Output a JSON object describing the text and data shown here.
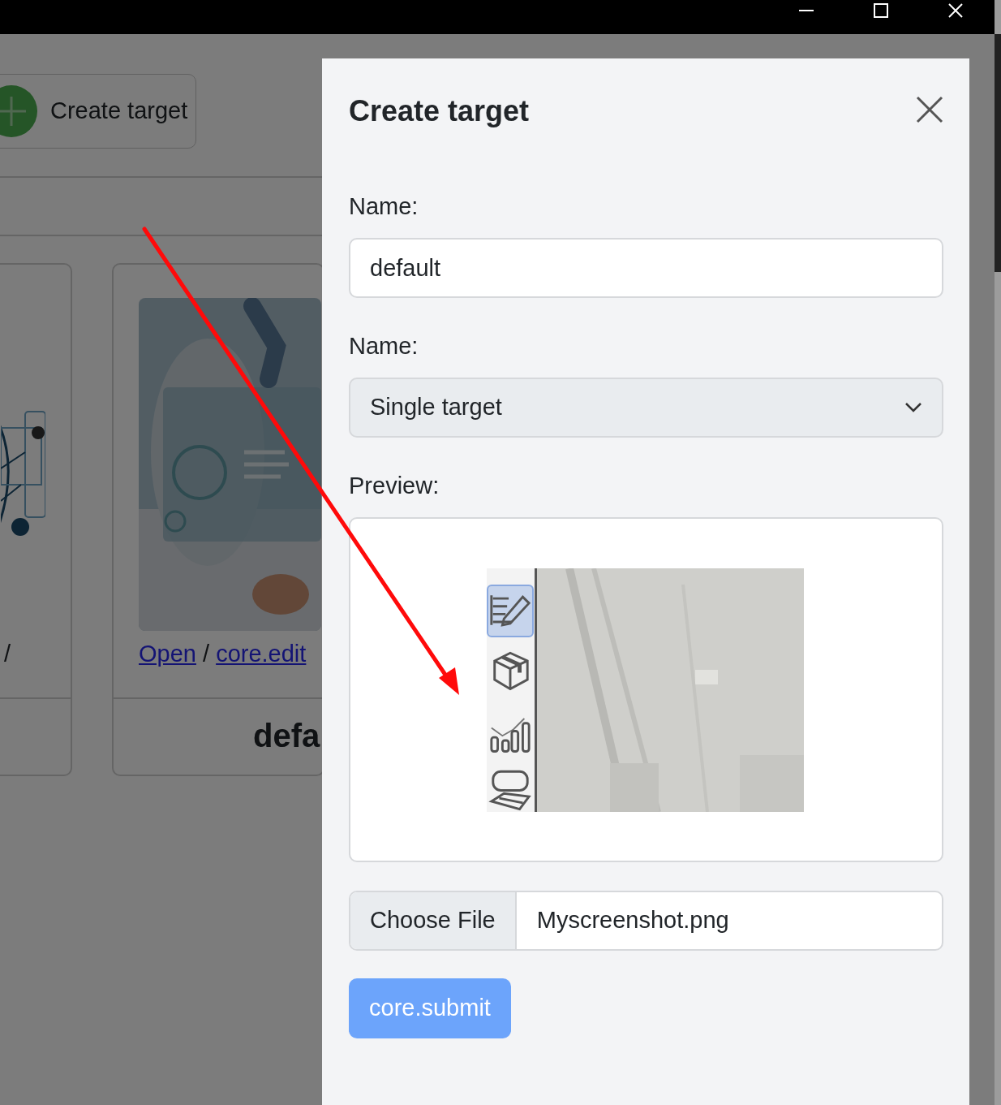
{
  "page": {
    "create_button": "Create target",
    "cards": [
      {
        "image": {
          "kind": "picture"
        },
        "links": [
          {
            "kind": "separator",
            "text": "/"
          }
        ]
      },
      {
        "image": {
          "kind": "picture"
        },
        "links": [
          {
            "kind": "link",
            "text": "Open"
          },
          {
            "kind": "separator",
            "text": "/"
          },
          {
            "kind": "link",
            "text": "core.edit"
          }
        ],
        "footer": "defa"
      }
    ]
  },
  "modal": {
    "title": "Create target",
    "fields": [
      {
        "kind": "text",
        "label": "Name:",
        "value": "default"
      },
      {
        "kind": "select",
        "label": "Name:",
        "value": "Single target",
        "disabled": true
      },
      {
        "kind": "preview",
        "label": "Preview:",
        "tools": [
          {
            "selected": true
          },
          {
            "selected": false
          },
          {
            "selected": false
          },
          {
            "selected": false
          }
        ]
      },
      {
        "kind": "file",
        "button": "Choose File",
        "value": "Myscreenshot.png"
      }
    ],
    "submit": {
      "label": "core.submit",
      "disabled": true
    }
  }
}
